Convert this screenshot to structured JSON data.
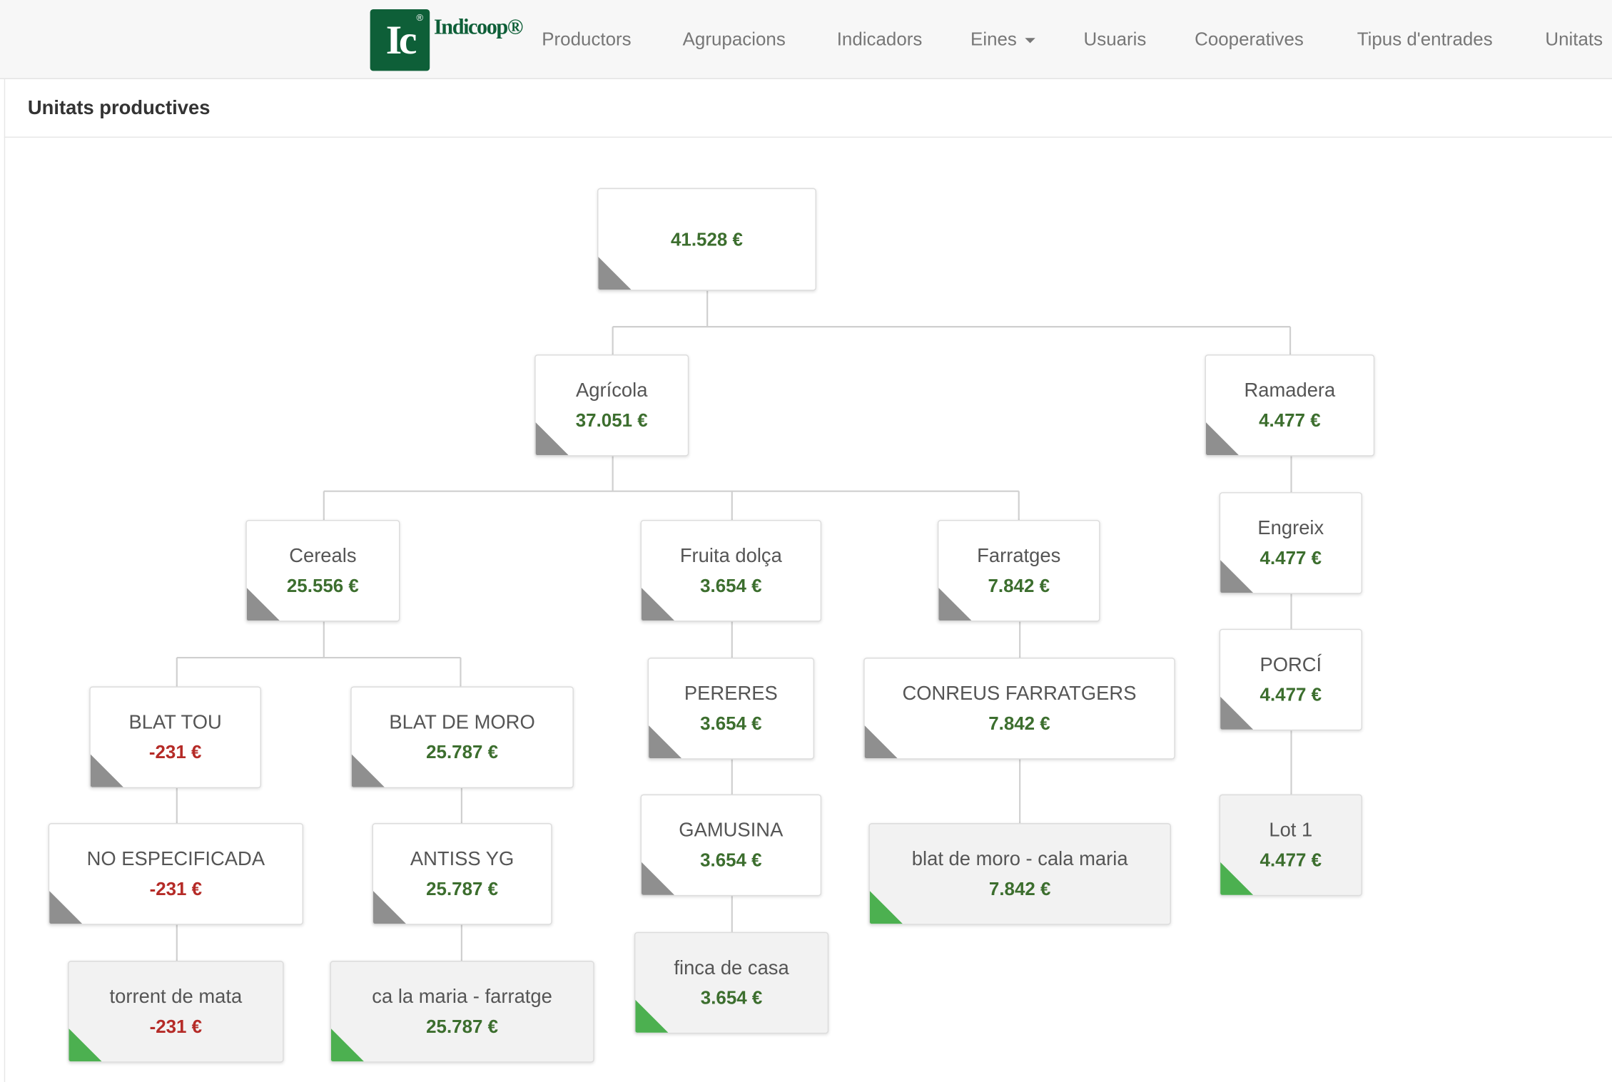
{
  "app": {
    "logo_text": "Ic",
    "logo_mark": "®",
    "name": "Indicoop®"
  },
  "nav": {
    "items": [
      {
        "label": "Productors"
      },
      {
        "label": "Agrupacions"
      },
      {
        "label": "Indicadors"
      },
      {
        "label": "Eines"
      },
      {
        "label": "Usuaris"
      },
      {
        "label": "Cooperatives"
      },
      {
        "label": "Tipus d'entrades"
      },
      {
        "label": "Unitats"
      }
    ]
  },
  "panel": {
    "title": "Unitats productives"
  },
  "tree": {
    "nodes": [
      {
        "name": "",
        "value": "41.528 €",
        "marker": "gray"
      },
      {
        "name": "Agrícola",
        "value": "37.051 €",
        "marker": "gray"
      },
      {
        "name": "Ramadera",
        "value": "4.477 €",
        "marker": "gray"
      },
      {
        "name": "Cereals",
        "value": "25.556 €",
        "marker": "gray"
      },
      {
        "name": "Fruita dolça",
        "value": "3.654 €",
        "marker": "gray"
      },
      {
        "name": "Farratges",
        "value": "7.842 €",
        "marker": "gray"
      },
      {
        "name": "Engreix",
        "value": "4.477 €",
        "marker": "gray"
      },
      {
        "name": "BLAT TOU",
        "value": "-231 €",
        "marker": "gray"
      },
      {
        "name": "BLAT DE MORO",
        "value": "25.787 €",
        "marker": "gray"
      },
      {
        "name": "PERERES",
        "value": "3.654 €",
        "marker": "gray"
      },
      {
        "name": "CONREUS FARRATGERS",
        "value": "7.842 €",
        "marker": "gray"
      },
      {
        "name": "PORCÍ",
        "value": "4.477 €",
        "marker": "gray"
      },
      {
        "name": "NO ESPECIFICADA",
        "value": "-231 €",
        "marker": "gray"
      },
      {
        "name": "ANTISS YG",
        "value": "25.787 €",
        "marker": "gray"
      },
      {
        "name": "GAMUSINA",
        "value": "3.654 €",
        "marker": "gray"
      },
      {
        "name": "blat de moro - cala maria",
        "value": "7.842 €",
        "marker": "green"
      },
      {
        "name": "Lot 1",
        "value": "4.477 €",
        "marker": "green"
      },
      {
        "name": "torrent de mata",
        "value": "-231 €",
        "marker": "green"
      },
      {
        "name": "ca la maria - farratge",
        "value": "25.787 €",
        "marker": "green"
      },
      {
        "name": "finca de casa",
        "value": "3.654 €",
        "marker": "green"
      }
    ]
  },
  "colors": {
    "positive": "#3c6e2e",
    "negative": "#b52b27",
    "brand": "#0e5f38",
    "marker_gray": "#8f8f8f",
    "marker_green": "#4cb050"
  }
}
